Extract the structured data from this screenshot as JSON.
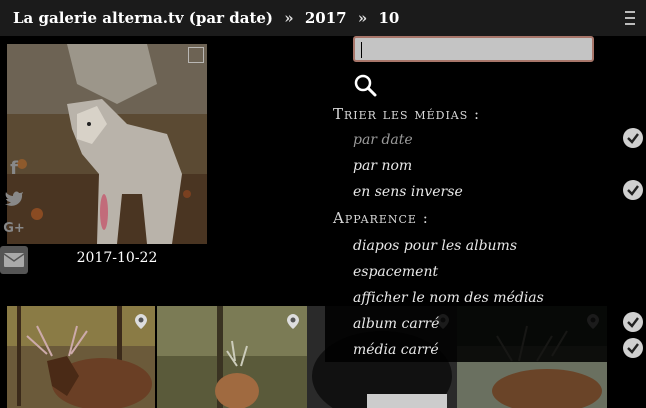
{
  "header": {
    "crumbs": [
      "La galerie alterna.tv (par date)",
      "2017",
      "10"
    ],
    "separator": "»"
  },
  "album": {
    "caption": "2017-10-22"
  },
  "social": {
    "facebook": "f",
    "twitter": "t",
    "googleplus": "G+",
    "email": ""
  },
  "panel": {
    "search_value": "",
    "sort_title": "Trier les médias :",
    "sort_options": [
      {
        "label": "par date",
        "checked": true,
        "active": true
      },
      {
        "label": "par nom",
        "checked": false,
        "active": false
      },
      {
        "label": "en sens inverse",
        "checked": true,
        "active": false
      }
    ],
    "appearance_title": "Apparence :",
    "appearance_options": [
      {
        "label": "diapos pour les albums",
        "checked": false
      },
      {
        "label": "espacement",
        "checked": false
      },
      {
        "label": "afficher le nom des médias",
        "checked": false
      },
      {
        "label": "album carré",
        "checked": true
      },
      {
        "label": "média carré",
        "checked": true
      }
    ]
  },
  "colors": {
    "accent_border": "#a8766a",
    "panel_bg": "#000000",
    "topbar_bg": "#1b1b1b"
  }
}
